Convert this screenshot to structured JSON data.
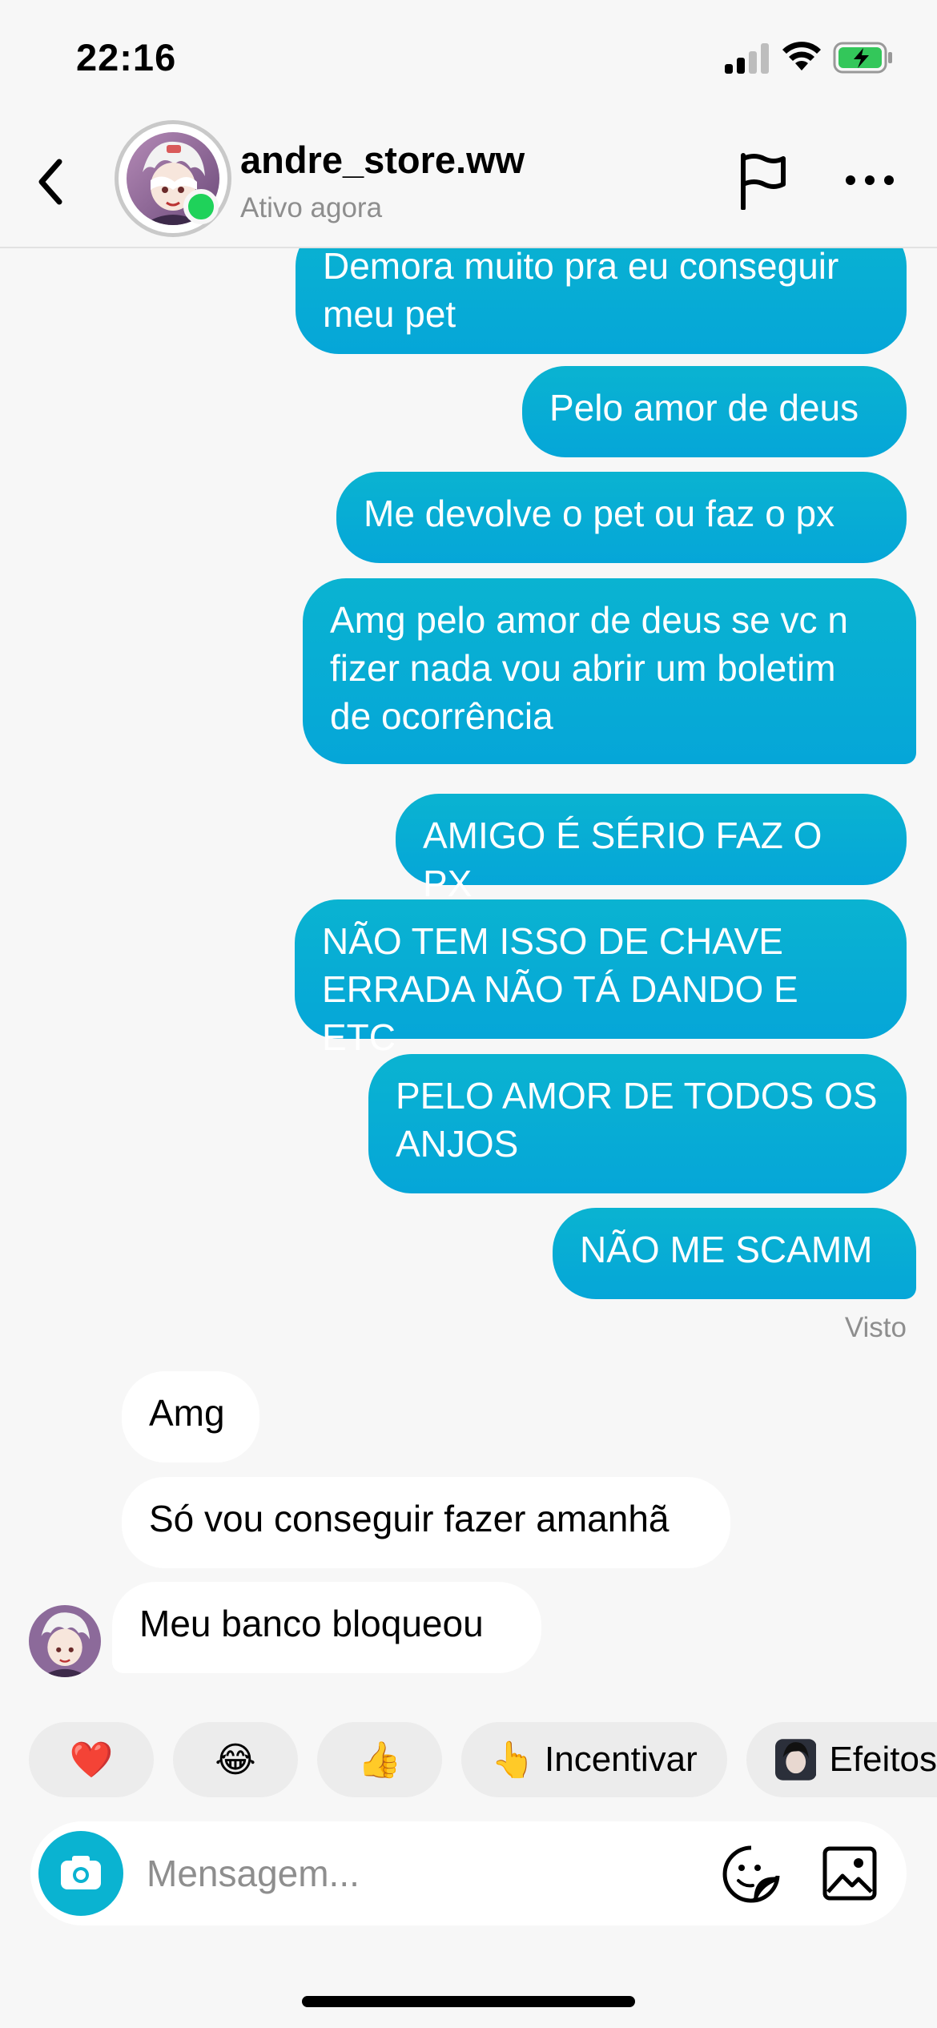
{
  "status_bar": {
    "time": "22:16",
    "battery_color": "#33c75a"
  },
  "header": {
    "username": "andre_store.ww",
    "presence": "Ativo agora",
    "online_color": "#1fd25a",
    "icons": [
      "back-chevron-icon",
      "flag-icon",
      "more-options-icon"
    ]
  },
  "messages": [
    {
      "from": "me",
      "text_lines": [
        "Demora muito pra eu conseguir",
        "meu pet"
      ]
    },
    {
      "from": "me",
      "text_lines": [
        "Pelo amor de deus"
      ]
    },
    {
      "from": "me",
      "text_lines": [
        "Me devolve o pet ou faz o px"
      ]
    },
    {
      "from": "me",
      "text_lines": [
        "Amg pelo amor de deus se vc n",
        "fizer nada vou abrir um boletim",
        "de ocorrência"
      ]
    },
    {
      "from": "me",
      "text_lines": [
        "AMIGO É SÉRIO FAZ O PX"
      ]
    },
    {
      "from": "me",
      "text_lines": [
        "NÃO TEM ISSO DE CHAVE",
        "ERRADA NÃO TÁ DANDO E ETC"
      ]
    },
    {
      "from": "me",
      "text_lines": [
        "PELO AMOR DE TODOS OS",
        "ANJOS"
      ]
    },
    {
      "from": "me",
      "text_lines": [
        "NÃO ME SCAMM"
      ]
    },
    {
      "from": "them",
      "text_lines": [
        "Amg"
      ]
    },
    {
      "from": "them",
      "text_lines": [
        "Só vou conseguir fazer amanhã"
      ]
    },
    {
      "from": "them",
      "text_lines": [
        "Meu banco bloqueou"
      ]
    }
  ],
  "seen_label": "Visto",
  "quick_reactions": [
    {
      "emoji": "❤️",
      "icon": "heart-icon",
      "label": ""
    },
    {
      "emoji": "😂",
      "icon": "laughing-face-icon",
      "label": ""
    },
    {
      "emoji": "👍",
      "icon": "thumbs-up-icon",
      "label": ""
    },
    {
      "emoji": "👆",
      "icon": "pointing-finger-icon",
      "label": "Incentivar"
    },
    {
      "emoji": "",
      "icon": "effects-thumbnail-icon",
      "label": "Efeitos"
    }
  ],
  "composer": {
    "placeholder": "Mensagem...",
    "accent_color": "#0ab3d1",
    "icons": [
      "camera-icon",
      "sticker-icon",
      "gallery-icon"
    ]
  },
  "colors": {
    "outgoing_bubble": "#05a6d8",
    "incoming_bubble": "#ffffff",
    "background": "#f7f7f7"
  }
}
